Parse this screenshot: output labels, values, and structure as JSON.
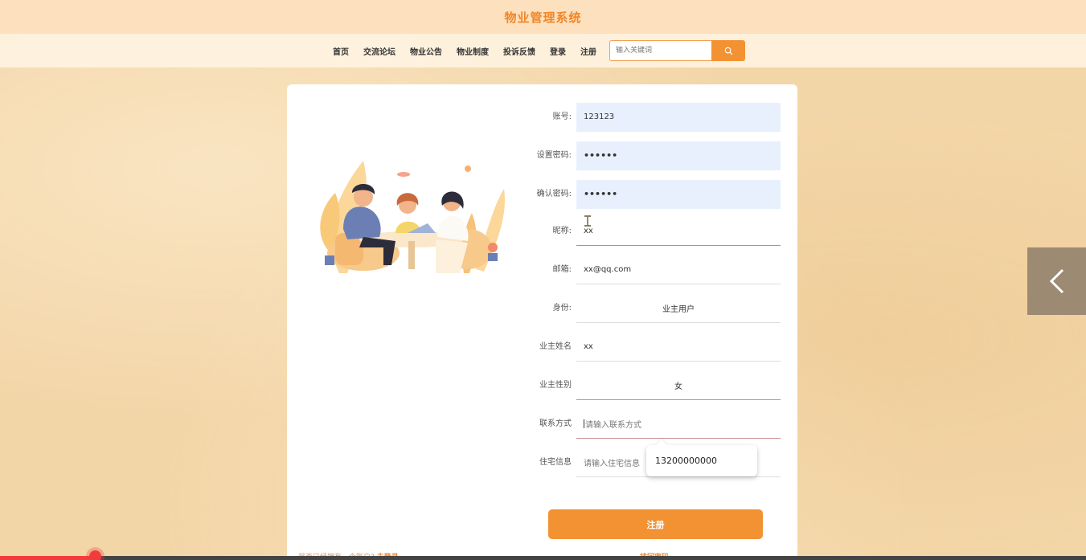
{
  "app": {
    "title": "物业管理系统"
  },
  "nav": {
    "items": [
      "首页",
      "交流论坛",
      "物业公告",
      "物业制度",
      "投诉反馈",
      "登录",
      "注册"
    ],
    "search_placeholder": "输入关键词"
  },
  "form": {
    "account": {
      "label": "账号:",
      "value": "123123"
    },
    "password": {
      "label": "设置密码:",
      "value": "••••••"
    },
    "confirm": {
      "label": "确认密码:",
      "value": "••••••"
    },
    "nickname": {
      "label": "昵称:",
      "value": "xx"
    },
    "email": {
      "label": "邮箱:",
      "value": "xx@qq.com"
    },
    "role": {
      "label": "身份:",
      "value": "业主用户"
    },
    "owner_name": {
      "label": "业主姓名",
      "value": "xx"
    },
    "owner_gender": {
      "label": "业主性别",
      "value": "女"
    },
    "contact": {
      "label": "联系方式",
      "placeholder": "请输入联系方式"
    },
    "address": {
      "label": "住宅信息",
      "placeholder": "请输入住宅信息"
    },
    "autocomplete_suggestion": "13200000000",
    "submit_label": "注册",
    "login_prompt": "是否已经拥有一个账户?",
    "login_link": "去登录",
    "forgot_link": "找回密码"
  },
  "colors": {
    "accent": "#f39233",
    "title": "#f0862a"
  }
}
